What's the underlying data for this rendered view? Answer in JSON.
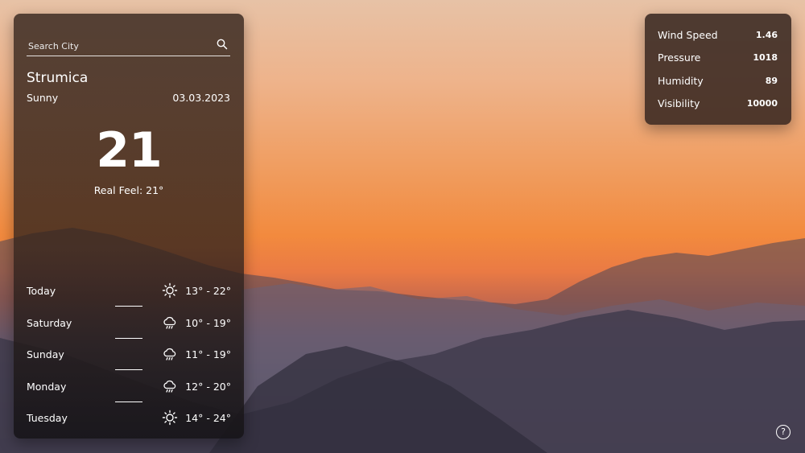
{
  "search": {
    "placeholder": "Search City",
    "icon": "search-icon"
  },
  "current": {
    "city": "Strumica",
    "condition": "Sunny",
    "date": "03.03.2023",
    "temperature": "21",
    "real_feel": "Real Feel: 21°"
  },
  "forecast": [
    {
      "day": "Today",
      "icon": "sun-icon",
      "range": "13° - 22°"
    },
    {
      "day": "Saturday",
      "icon": "rain-icon",
      "range": "10° - 19°"
    },
    {
      "day": "Sunday",
      "icon": "rain-icon",
      "range": "11° - 19°"
    },
    {
      "day": "Monday",
      "icon": "rain-icon",
      "range": "12° - 20°"
    },
    {
      "day": "Tuesday",
      "icon": "sun-icon",
      "range": "14° - 24°"
    }
  ],
  "details": [
    {
      "label": "Wind Speed",
      "value": "1.46"
    },
    {
      "label": "Pressure",
      "value": "1018"
    },
    {
      "label": "Humidity",
      "value": "89"
    },
    {
      "label": "Visibility",
      "value": "10000"
    }
  ],
  "help": {
    "label": "?",
    "icon": "help-icon"
  }
}
